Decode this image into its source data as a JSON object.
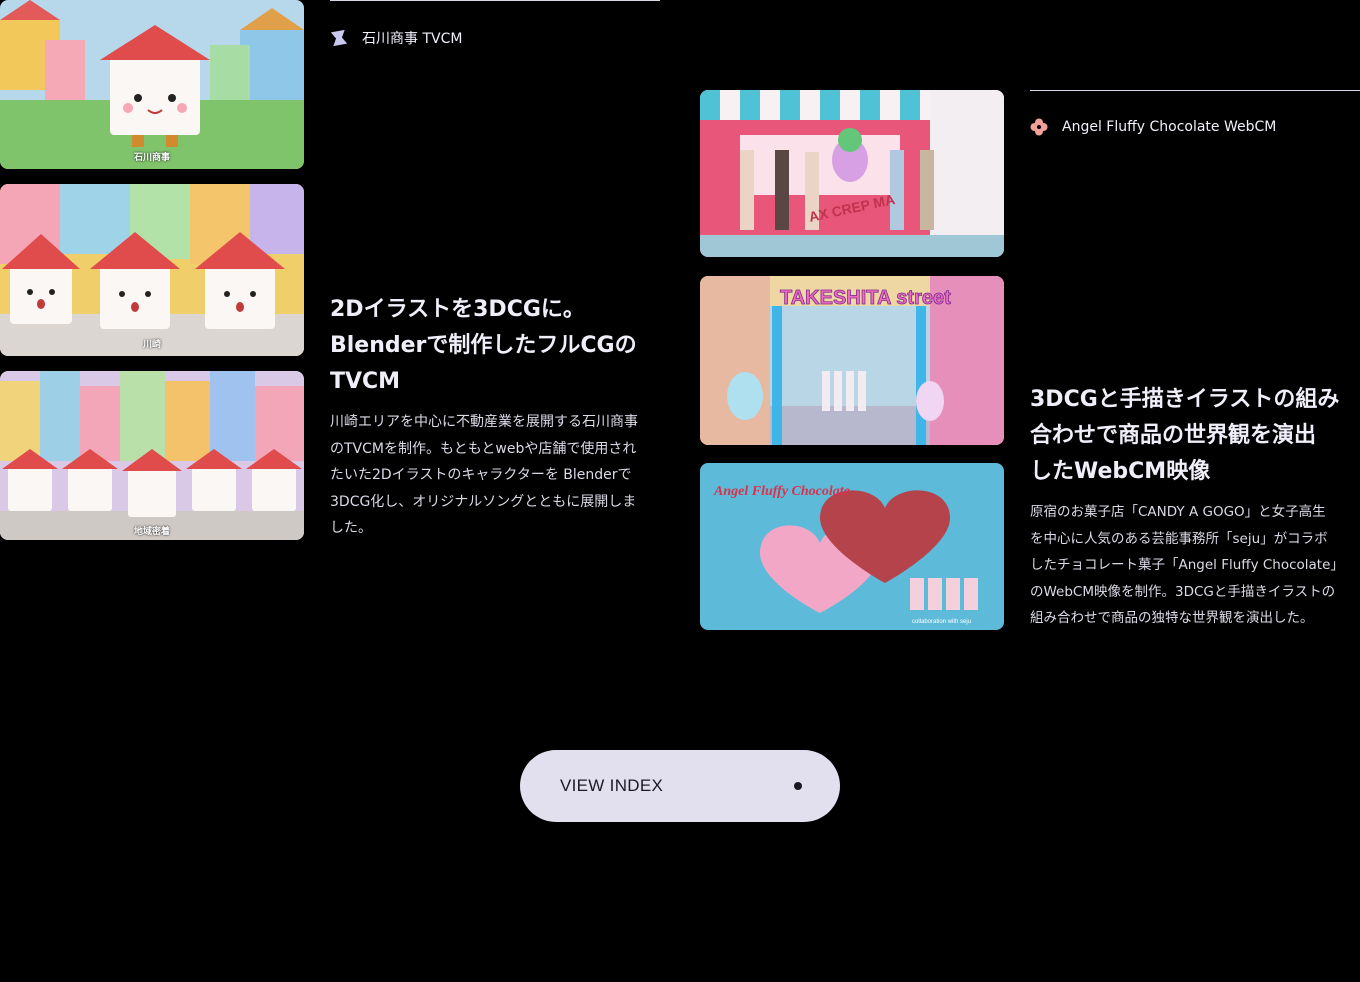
{
  "project1": {
    "tag_label": "石川商事 TVCM",
    "heading_lines": [
      "2Dイラストを3DCGに。",
      "Blenderで制作したフルCGの",
      "TVCM"
    ],
    "description_lines": [
      "川崎エリアを中心に不動産業を展開する石川商事",
      "のTVCMを制作。もともとwebや店舗で使用され",
      "たいた2Dイラストのキャラクターを Blenderで",
      "3DCG化し、オリジナルソングとともに展開しま",
      "した。"
    ],
    "thumbnails": [
      {
        "caption": "石川商事"
      },
      {
        "caption": "川崎"
      },
      {
        "caption": "地域密着"
      }
    ]
  },
  "project2": {
    "tag_label": "Angel Fluffy Chocolate WebCM",
    "heading_lines": [
      "3DCGと手描きイラストの組み",
      "合わせで商品の世界観を演出",
      "したWebCM映像"
    ],
    "description_lines": [
      "原宿のお菓子店「CANDY A GOGO」と女子高生",
      "を中心に人気のある芸能事務所「seju」がコラボ",
      "したチョコレート菓子「Angel Fluffy Chocolate」",
      "のWebCM映像を制作。3DCGと手描きイラストの",
      "組み合わせで商品の独特な世界観を演出した。"
    ],
    "thumbnails": [
      {
        "caption": "AX CREP MA"
      },
      {
        "caption": "TAKESHITA street"
      },
      {
        "caption": "Angel Fluffy Chocolate"
      }
    ],
    "footnote": "collaboration with seju"
  },
  "view_index_button": {
    "label": "VIEW INDEX"
  },
  "icons": {
    "project1_tag": "star-icon",
    "project2_tag": "flower-icon",
    "button_dot": "dot-icon"
  },
  "colors": {
    "background": "#000000",
    "button_bg": "#e2e0ef",
    "text": "#e6e4f0"
  }
}
